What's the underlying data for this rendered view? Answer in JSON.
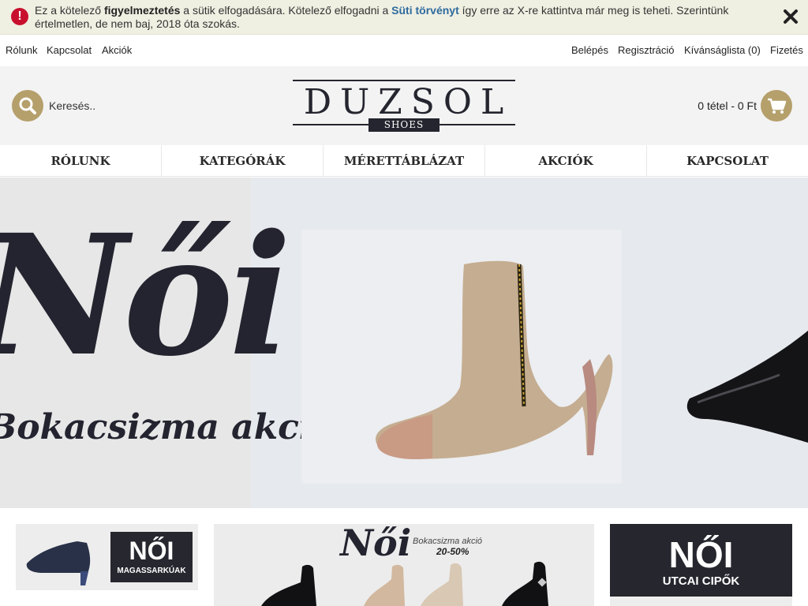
{
  "cookie": {
    "part1": "Ez a kötelező ",
    "bold1": "figyelmeztetés",
    "part2": " a sütik elfogadására. Kötelező elfogadni a ",
    "link": "Süti törvényt",
    "part3": " így erre az X-re kattintva már meg is teheti. Szerintünk értelmetlen, de nem baj, 2018 óta szokás."
  },
  "toplinks": {
    "left": [
      "Rólunk",
      "Kapcsolat",
      "Akciók"
    ],
    "right": [
      "Belépés",
      "Regisztráció",
      "Kívánságlista (0)",
      "Fizetés"
    ]
  },
  "header": {
    "search_placeholder": "Keresés..",
    "logo_word": "DUZSOL",
    "logo_tag": "SHOES",
    "cart": "0 tétel - 0 Ft"
  },
  "nav": [
    "RÓLUNK",
    "KATEGÓRÁK",
    "MÉRETTÁBLÁZAT",
    "AKCIÓK",
    "KAPCSOLAT"
  ],
  "hero": {
    "title": "Női",
    "subtitle": "Bokacsizma akció"
  },
  "promos": {
    "p1_title": "NŐI",
    "p1_sub": "MAGASSARKÚAK",
    "p2_title": "Női",
    "p2_sub1": "Bokacsizma akció",
    "p2_sub2": "20-50%",
    "p3_title": "NŐI",
    "p3_sub": "UTCAI CIPŐK"
  },
  "colors": {
    "accent": "#b59f6b",
    "dark": "#24252e",
    "alert": "#c8102e",
    "link": "#2e6a9e"
  },
  "icons": [
    "alert-icon",
    "close-icon",
    "search-icon",
    "cart-icon"
  ]
}
